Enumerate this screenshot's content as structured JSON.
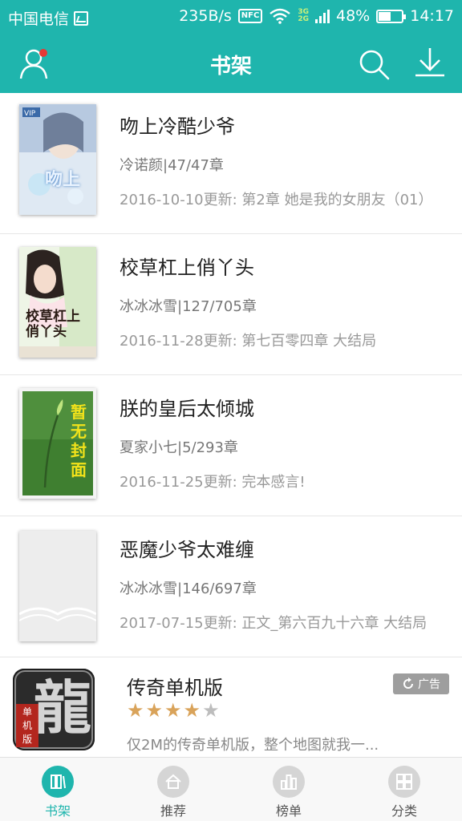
{
  "status_bar": {
    "carrier": "中国电信",
    "speed": "235B/s",
    "nfc": "NFC",
    "net_top": "3G",
    "net_bottom": "2G",
    "battery": "48%",
    "time": "14:17"
  },
  "header": {
    "title": "书架",
    "left_icon": "user-icon",
    "right_icons": [
      "search-icon",
      "download-icon"
    ],
    "accent": "#1fb5ad",
    "notification_dot_color": "#e53935"
  },
  "books": [
    {
      "title": "吻上冷酷少爷",
      "meta": "冷诺颜|47/47章",
      "update": "2016-10-10更新: 第2章 她是我的女朋友（01）",
      "cover_text": "吻上"
    },
    {
      "title": "校草杠上俏丫头",
      "meta": "冰冰冰雪|127/705章",
      "update": "2016-11-28更新: 第七百零四章 大结局",
      "cover_text": "校草杠上俏丫头"
    },
    {
      "title": "朕的皇后太倾城",
      "meta": "夏家小七|5/293章",
      "update": "2016-11-25更新: 完本感言!",
      "cover_text": "暂无封面"
    },
    {
      "title": "恶魔少爷太难缠",
      "meta": "冰冰冰雪|146/697章",
      "update": "2017-07-15更新: 正文_第六百九十六章 大结局",
      "cover_text": ""
    }
  ],
  "ad": {
    "title": "传奇单机版",
    "rating": 4,
    "rating_max": 5,
    "description": "仅2M的传奇单机版，整个地图就我一...",
    "badge": "广告",
    "icon_main_char": "龍",
    "icon_sub_text": [
      "单",
      "机",
      "版"
    ]
  },
  "tabs": [
    {
      "label": "书架",
      "icon": "bookshelf-icon",
      "active": true
    },
    {
      "label": "推荐",
      "icon": "home-icon",
      "active": false
    },
    {
      "label": "榜单",
      "icon": "ranking-icon",
      "active": false
    },
    {
      "label": "分类",
      "icon": "category-icon",
      "active": false
    }
  ]
}
